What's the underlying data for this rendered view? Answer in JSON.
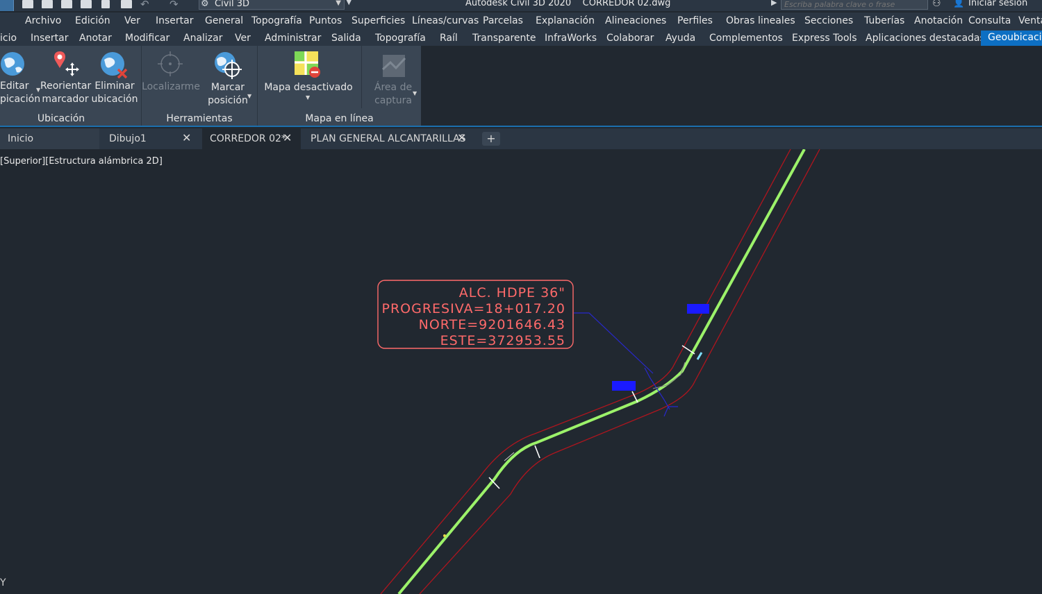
{
  "titlebar": {
    "workspace": "Civil 3D",
    "title": "Autodesk Civil 3D 2020    CORREDOR 02.dwg",
    "search_placeholder": "Escriba palabra clave o frase",
    "signin": "Iniciar sesión"
  },
  "menu": [
    "Archivo",
    "Edición",
    "Ver",
    "Insertar",
    "General",
    "Topografía",
    "Puntos",
    "Superficies",
    "Líneas/curvas",
    "Parcelas",
    "Explanación",
    "Alineaciones",
    "Perfiles",
    "Obras lineales",
    "Secciones",
    "Tuberías",
    "Anotación",
    "Consulta",
    "Venta"
  ],
  "ribbon_tabs": [
    "icio",
    "Insertar",
    "Anotar",
    "Modificar",
    "Analizar",
    "Ver",
    "Administrar",
    "Salida",
    "Topografía",
    "Raíl",
    "Transparente",
    "InfraWorks",
    "Colaborar",
    "Ayuda",
    "Complementos",
    "Express Tools",
    "Aplicaciones destacadas",
    "Geoubicació"
  ],
  "ribbon": {
    "ubicacion": {
      "label": "Ubicación",
      "editar": "Editar\npicación",
      "reorientar": "Reorientar\nmarcador",
      "eliminar": "Eliminar\nubicación"
    },
    "herramientas": {
      "label": "Herramientas",
      "localizarme": "Localizarme",
      "marcar": "Marcar\nposición"
    },
    "mapa": {
      "label": "Mapa en línea",
      "mapa_desactivado": "Mapa desactivado",
      "area": "Área de\ncaptura"
    }
  },
  "doc_tabs": [
    "Inicio",
    "Dibujo1",
    "CORREDOR 02*",
    "PLAN GENERAL ALCANTARILLAS"
  ],
  "viewport_label": "[Superior][Estructura alámbrica 2D]",
  "annotation": {
    "line1": "ALC. HDPE 36\"",
    "line2": "PROGRESIVA=18+017.20",
    "line3": "NORTE=9201646.43",
    "line4": "ESTE=372953.55"
  },
  "colors": {
    "background": "#212830",
    "ui_dark": "#2b3643",
    "ribbon_panel": "#3a4654",
    "active_tab": "#0d6fc3",
    "alignment_green": "#9cf26a",
    "corridor_red": "#b0151e",
    "annotation_red": "#ff6a6a",
    "culvert_blue": "#1a1aff"
  }
}
